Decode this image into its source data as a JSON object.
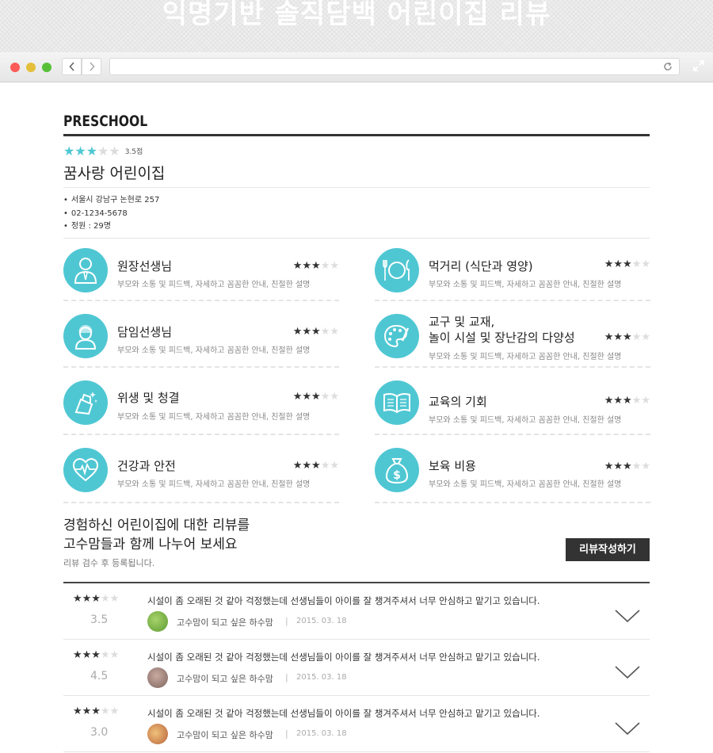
{
  "banner": {
    "title": "익명기반 솔직담백 어린이집 리뷰"
  },
  "browser": {
    "back_icon": "chevron-left-icon",
    "forward_icon": "chevron-right-icon",
    "reload_icon": "reload-icon",
    "expand_icon": "expand-icon"
  },
  "brand": "PRESCHOOL",
  "school": {
    "rating_score": "3.5점",
    "rating_stars": 3,
    "name": "꿈사랑 어린이집",
    "address": "서울시 강남구 논현로 257",
    "phone": "02-1234-5678",
    "capacity": "정원 : 29명"
  },
  "categories": [
    {
      "title": "원장선생님",
      "desc": "부모와 소통 및 피드백, 자세하고 꼼꼼한 안내, 친절한 설명",
      "stars": 3,
      "icon": "principal-icon"
    },
    {
      "title": "먹거리 (식단과 영양)",
      "desc": "부모와 소통 및 피드백, 자세하고 꼼꼼한 안내, 친절한 설명",
      "stars": 3,
      "icon": "meal-icon"
    },
    {
      "title": "담임선생님",
      "desc": "부모와 소통 및 피드백, 자세하고 꼼꼼한 안내, 친절한 설명",
      "stars": 3,
      "icon": "teacher-icon"
    },
    {
      "title1": "교구 및 교재,",
      "title2": "놀이 시설 및 장난감의 다양성",
      "desc": "부모와 소통 및 피드백, 자세하고 꼼꼼한 안내, 친절한 설명",
      "stars": 3,
      "icon": "palette-icon"
    },
    {
      "title": "위생 및 청결",
      "desc": "부모와 소통 및 피드백, 자세하고 꼼꼼한 안내, 친절한 설명",
      "stars": 3,
      "icon": "cleaning-icon"
    },
    {
      "title": "교육의 기회",
      "desc": "부모와 소통 및 피드백, 자세하고 꼼꼼한 안내, 친절한 설명",
      "stars": 3,
      "icon": "book-icon"
    },
    {
      "title": "건강과 안전",
      "desc": "부모와 소통 및 피드백, 자세하고 꼼꼼한 안내, 친절한 설명",
      "stars": 3,
      "icon": "heart-pulse-icon"
    },
    {
      "title": "보육 비용",
      "desc": "부모와 소통 및 피드백, 자세하고 꼼꼼한 안내, 친절한 설명",
      "stars": 3,
      "icon": "money-bag-icon"
    }
  ],
  "cta": {
    "line1": "경험하신 어린이집에 대한 리뷰를",
    "line2": "고수맘들과 함께 나누어 보세요",
    "sub": "리뷰 검수 후 등록됩니다.",
    "button": "리뷰작성하기"
  },
  "reviews": [
    {
      "stars": 3,
      "score": "3.5",
      "text": "시설이 좀 오래된 것 같아 걱정했는데 선생님들이 아이를 잘 챙겨주셔서 너무 안심하고 맡기고 있습니다.",
      "author": "고수맘이 되고 싶은 하수맘",
      "separator": "|",
      "date": "2015. 03. 18",
      "avatar_color": "#7db84a"
    },
    {
      "stars": 3,
      "score": "4.5",
      "text": "시설이 좀 오래된 것 같아 걱정했는데 선생님들이 아이를 잘 챙겨주셔서 너무 안심하고 맡기고 있습니다.",
      "author": "고수맘이 되고 싶은 하수맘",
      "separator": "|",
      "date": "2015. 03. 18",
      "avatar_color": "#a78b85"
    },
    {
      "stars": 3,
      "score": "3.0",
      "text": "시설이 좀 오래된 것 같아 걱정했는데 선생님들이 아이를 잘 챙겨주셔서 너무 안심하고 맡기고 있습니다.",
      "author": "고수맘이 되고 싶은 하수맘",
      "separator": "|",
      "date": "2015. 03. 18",
      "avatar_color": "#d49a6a"
    }
  ],
  "colors": {
    "accent": "#4fc7d3",
    "dark": "#333333"
  }
}
